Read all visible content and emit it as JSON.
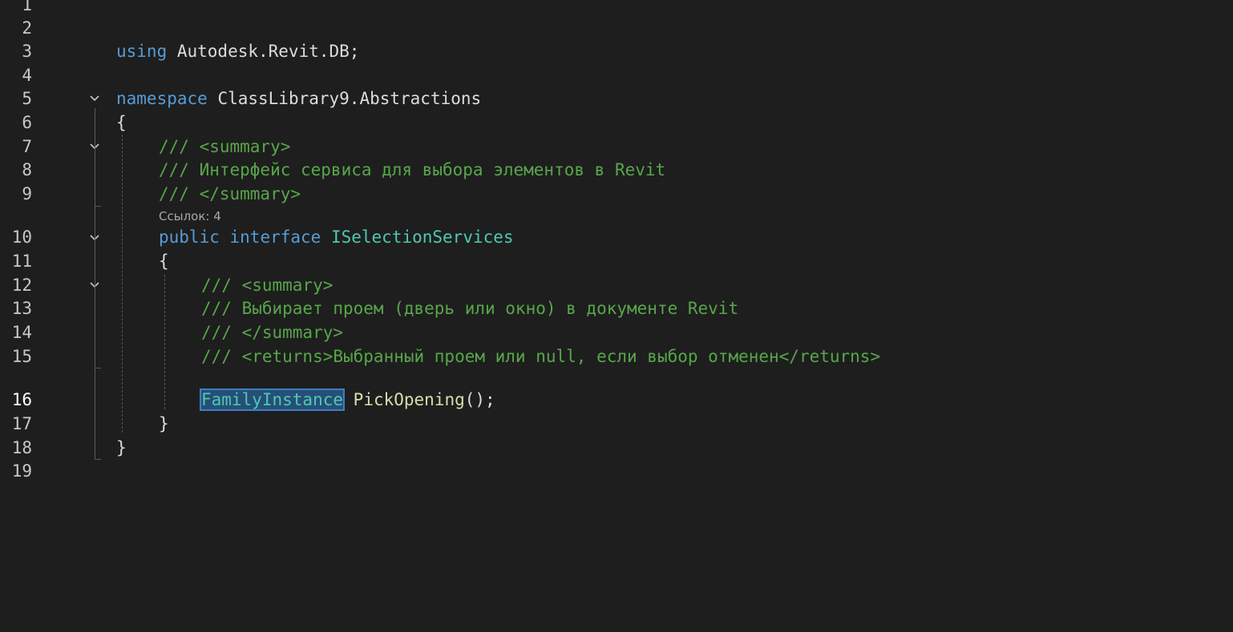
{
  "editor": {
    "line_numbers": [
      "1",
      "2",
      "3",
      "4",
      "5",
      "6",
      "7",
      "8",
      "9",
      "10",
      "11",
      "12",
      "13",
      "14",
      "15",
      "16",
      "17",
      "18",
      "19"
    ],
    "current_line": "16",
    "codelens": "Ссылок: 4",
    "lines": {
      "l3": {
        "kw": "using",
        "rest": " Autodesk.Revit.DB;"
      },
      "l5": {
        "kw": "namespace",
        "rest": " ClassLibrary9.Abstractions"
      },
      "l6": {
        "text": "{"
      },
      "l7": {
        "text": "/// <summary>"
      },
      "l8": {
        "text": "/// Интерфейс сервиса для выбора элементов в Revit"
      },
      "l9": {
        "text": "/// </summary>"
      },
      "l10": {
        "kw1": "public",
        "kw2": "interface",
        "name": "ISelectionServices"
      },
      "l11": {
        "text": "{"
      },
      "l12": {
        "text": "/// <summary>"
      },
      "l13": {
        "text": "/// Выбирает проем (дверь или окно) в документе Revit"
      },
      "l14": {
        "text": "/// </summary>"
      },
      "l15": {
        "text": "/// <returns>Выбранный проем или null, если выбор отменен</returns>"
      },
      "l16": {
        "type": "FamilyInstance",
        "method": "PickOpening",
        "rest": "();"
      },
      "l17": {
        "text": "}"
      },
      "l18": {
        "text": "}"
      }
    },
    "colors": {
      "background": "#1e1e1e",
      "keyword": "#569cd6",
      "type": "#4ec9b0",
      "comment": "#57a64a",
      "method": "#dcdcaa",
      "selection": "#264f78"
    },
    "fold_icons": [
      "chevron-down-icon",
      "chevron-down-icon",
      "chevron-down-icon",
      "chevron-down-icon"
    ]
  }
}
